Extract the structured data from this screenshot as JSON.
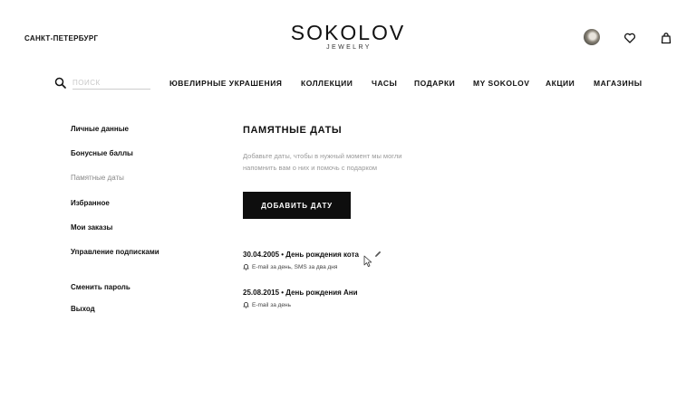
{
  "header": {
    "city": "САНКТ-ПЕТЕРБУРГ",
    "logo_main": "SOKOLOV",
    "logo_sub": "JEWELRY"
  },
  "search": {
    "placeholder": "ПОИСК"
  },
  "nav": {
    "items": [
      "ЮВЕЛИРНЫЕ УКРАШЕНИЯ",
      "КОЛЛЕКЦИИ",
      "ЧАСЫ",
      "ПОДАРКИ",
      "MY SOKOLOV",
      "АКЦИИ",
      "МАГАЗИНЫ"
    ]
  },
  "sidebar": {
    "items": [
      "Личные данные",
      "Бонусные баллы",
      "Памятные даты",
      "Избранное",
      "Мои заказы",
      "Управление подписками"
    ],
    "change_password": "Сменить пароль",
    "logout": "Выход",
    "active_item": "Памятные даты"
  },
  "main": {
    "title": "ПАМЯТНЫЕ ДАТЫ",
    "description_line1": "Добавьте даты, чтобы в нужный момент мы могли",
    "description_line2": "напомнить вам о них и помочь с подарком",
    "add_button": "ДОБАВИТЬ ДАТУ",
    "dates": [
      {
        "title": "30.04.2005 • День рождения кота",
        "notification": "E-mail за день, SMS за два дня"
      },
      {
        "title": "25.08.2015 • День рождения Ани",
        "notification": "E-mail за день"
      }
    ]
  },
  "icons": [
    "avatar",
    "heart-icon",
    "bag-icon",
    "search-icon",
    "edit-pencil-icon",
    "bell-icon",
    "mouse-cursor-icon"
  ]
}
